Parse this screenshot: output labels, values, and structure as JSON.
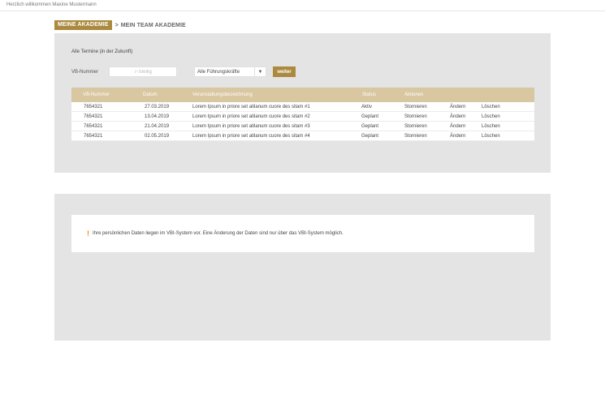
{
  "header": {
    "welcome": "Herzlich willkommen Maxine Mustermann"
  },
  "breadcrumb": {
    "active": "MEINE AKADEMIE",
    "separator": ">",
    "current": "MEIN TEAM AKADEMIE"
  },
  "colors": {
    "accent": "#ab8a3f",
    "table_header": "#d8c7a0",
    "panel_bg": "#e4e4e4",
    "warning": "#ee8a1a"
  },
  "termine": {
    "title": "Alle Termine (in der Zukunft)",
    "filter": {
      "vb_label": "VB-Nummer",
      "vb_placeholder": "7-Stellig",
      "vb_value": "",
      "select_value": "Alle Führungskräfte",
      "select_arrow": "▼",
      "submit_label": "weiter"
    },
    "columns": [
      "VB-Nummer",
      "Datum",
      "Veranstaltungsbezeichnung",
      "Status",
      "Aktionen"
    ],
    "rows": [
      {
        "vb": "7654321",
        "datum": "27.03.2019",
        "bezeichnung": "Lorem Ipsum in priore set atilanum cuore des sitam #1",
        "status": "Aktiv",
        "a1": "Stornieren",
        "a2": "Ändern",
        "a3": "Löschen"
      },
      {
        "vb": "7654321",
        "datum": "13.04.2019",
        "bezeichnung": "Lorem Ipsum in priore set atilanum cuore des sitam #2",
        "status": "Geplant",
        "a1": "Stornieren",
        "a2": "Ändern",
        "a3": "Löschen"
      },
      {
        "vb": "7654321",
        "datum": "21.04.2019",
        "bezeichnung": "Lorem Ipsum in priore set atilanum cuore des sitam #3",
        "status": "Geplant",
        "a1": "Stornieren",
        "a2": "Ändern",
        "a3": "Löschen"
      },
      {
        "vb": "7654321",
        "datum": "02.05.2019",
        "bezeichnung": "Lorem Ipsum in priore set atilanum cuore des sitam #4",
        "status": "Geplant",
        "a1": "Stornieren",
        "a2": "Ändern",
        "a3": "Löschen"
      }
    ]
  },
  "notice": {
    "icon": "exclamation-icon",
    "icon_glyph": "!",
    "text": "Ihre persönlichen Daten liegen im VBI-System vor. Eine Änderung der Daten sind nur über das VBI-System möglich."
  }
}
